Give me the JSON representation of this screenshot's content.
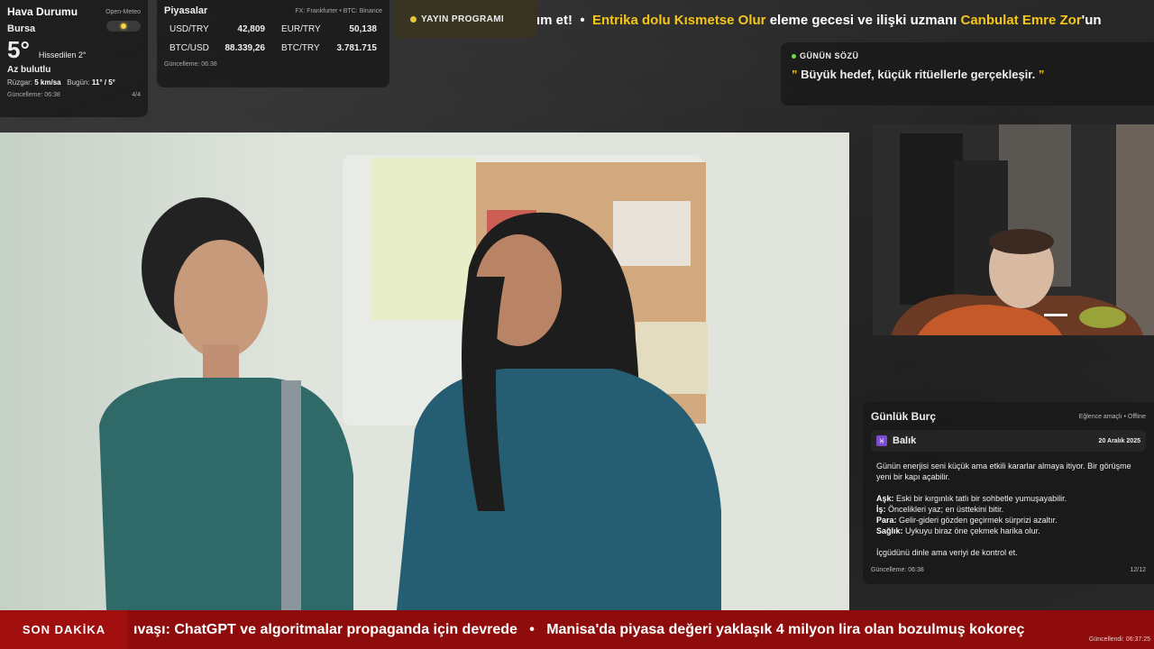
{
  "weather": {
    "title": "Hava Durumu",
    "source": "Open-Meteo",
    "city": "Bursa",
    "temp": "5°",
    "feels_like": "Hissedilen 2°",
    "condition": "Az bulutlu",
    "wind_label": "Rüzgar:",
    "wind_value": "5 km/sa",
    "today_label": "Bugün:",
    "today_value": "11° / 5°",
    "updated": "Güncelleme: 06:38",
    "page": "4/4"
  },
  "markets": {
    "title": "Piyasalar",
    "source": "FX: Frankfurter • BTC: Binance",
    "rates": [
      {
        "pair": "USD/TRY",
        "value": "42,809"
      },
      {
        "pair": "EUR/TRY",
        "value": "50,138"
      },
      {
        "pair": "BTC/USD",
        "value": "88.339,26"
      },
      {
        "pair": "BTC/TRY",
        "value": "3.781.715"
      }
    ],
    "updated": "Güncelleme: 06:38"
  },
  "schedule": {
    "label": "YAYIN PROGRAMI"
  },
  "top_ticker": {
    "seg1": "ım et!",
    "sep": "•",
    "seg2": "Entrika dolu Kısmetse Olur",
    "seg3": "eleme gecesi ve ilişki uzmanı",
    "seg4": "Canbulat Emre Zor",
    "seg5": "'un"
  },
  "quote": {
    "label": "GÜNÜN SÖZÜ",
    "open_mark": "”",
    "text": "Büyük hedef, küçük ritüellerle gerçekleşir.",
    "close_mark": "”"
  },
  "horoscope": {
    "title": "Günlük Burç",
    "meta": "Eğlence amaçlı • Offline",
    "sign_symbol": "♓",
    "sign": "Balık",
    "date": "20 Aralık 2025",
    "intro": "Günün enerjisi seni küçük ama etkili kararlar almaya itiyor. Bir görüşme yeni bir kapı açabilir.",
    "love_label": "Aşk:",
    "love": "Eski bir kırgınlık tatlı bir sohbetle yumuşayabilir.",
    "work_label": "İş:",
    "work": "Öncelikleri yaz; en üsttekini bitir.",
    "money_label": "Para:",
    "money": "Gelir-gideri gözden geçirmek sürprizi azaltır.",
    "health_label": "Sağlık:",
    "health": "Uykuyu biraz öne çekmek harika olur.",
    "closing": "İçgüdünü dinle ama veriyi de kontrol et.",
    "updated": "Güncelleme: 06:38",
    "page": "12/12"
  },
  "news": {
    "label": "SON DAKİKA",
    "item1": "ıvaşı: ChatGPT ve algoritmalar propaganda için devrede",
    "sep": "•",
    "item2": "Manisa'da piyasa değeri yaklaşık 4 milyon lira olan bozulmuş kokoreç",
    "updated": "Güncellendi: 06:37:25"
  },
  "colors": {
    "accent_yellow": "#f5c518",
    "news_red": "#8f0c0c",
    "live_green": "#6fdc4c"
  }
}
